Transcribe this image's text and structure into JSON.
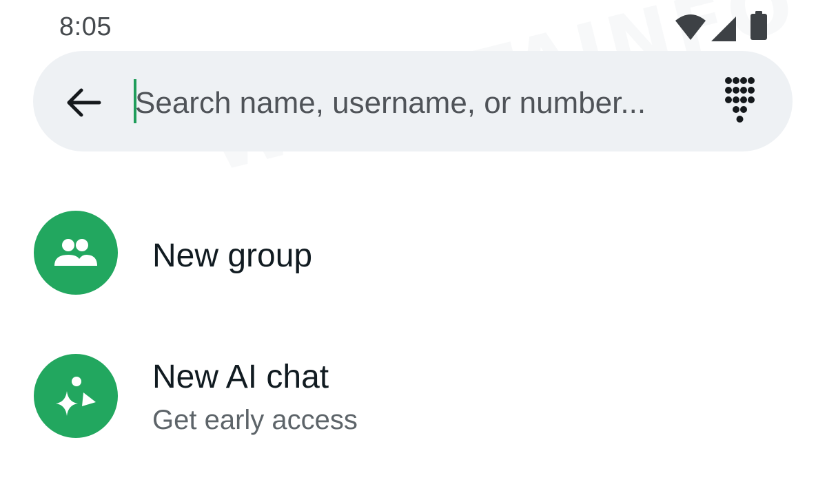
{
  "status_bar": {
    "time": "8:05",
    "icons": [
      "wifi-icon",
      "cellular-signal-icon",
      "battery-icon"
    ]
  },
  "search": {
    "placeholder": "Search name, username, or number...",
    "value": "",
    "back_icon": "back-arrow-icon",
    "dialpad_icon": "dialpad-icon"
  },
  "list": {
    "items": [
      {
        "title": "New group",
        "subtitle": "",
        "icon": "group-icon"
      },
      {
        "title": "New AI chat",
        "subtitle": "Get early access",
        "icon": "ai-sparkle-icon"
      }
    ]
  },
  "watermark": {
    "text": "WABETAINFO"
  },
  "colors": {
    "accent_green": "#22a75f",
    "search_bg": "#eef1f4",
    "primary_text": "#111b21",
    "secondary_text": "#5d6469"
  }
}
